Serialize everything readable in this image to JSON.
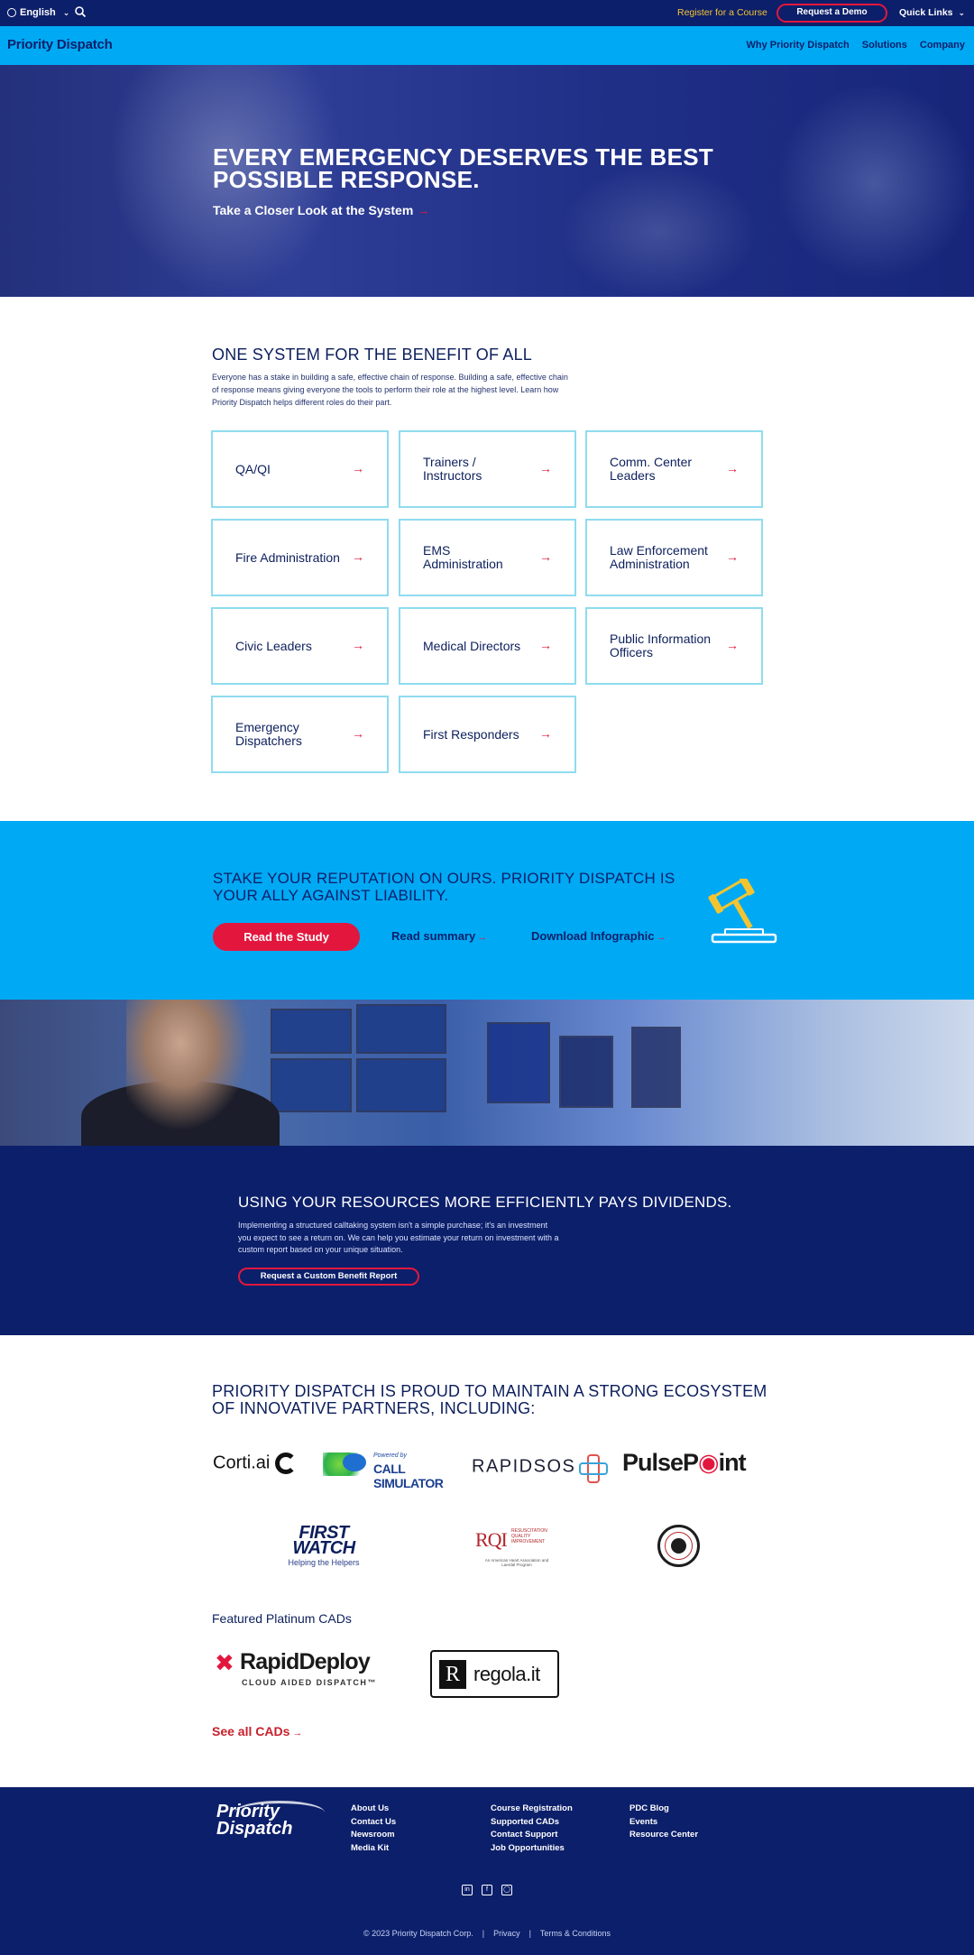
{
  "topbar": {
    "language": "English",
    "register": "Register for a Course",
    "demo": "Request a Demo",
    "quick_links": "Quick Links"
  },
  "nav": {
    "logo": "Priority Dispatch",
    "links": [
      "Why Priority Dispatch",
      "Solutions",
      "Company"
    ]
  },
  "hero": {
    "title": "EVERY EMERGENCY DESERVES THE BEST POSSIBLE RESPONSE.",
    "subtitle": "Take a Closer Look at the System"
  },
  "one_system": {
    "title": "ONE SYSTEM FOR THE BENEFIT OF ALL",
    "text": "Everyone has a stake in building a safe, effective chain of response. Building a safe, effective chain of response means giving everyone the tools to perform their role at the highest level. Learn how Priority Dispatch helps different roles do their part.",
    "cards": [
      "QA/QI",
      "Trainers / Instructors",
      "Comm. Center Leaders",
      "Fire Administration",
      "EMS Administration",
      "Law Enforcement Administration",
      "Civic Leaders",
      "Medical Directors",
      "Public Information Officers",
      "Emergency Dispatchers",
      "First Responders"
    ]
  },
  "liability": {
    "title": "STAKE YOUR REPUTATION ON OURS. PRIORITY DISPATCH IS YOUR ALLY AGAINST LIABILITY.",
    "study_button": "Read the Study",
    "summary_link": "Read summary",
    "infographic_link": "Download Infographic"
  },
  "dividends": {
    "title": "USING YOUR RESOURCES MORE EFFICIENTLY PAYS DIVIDENDS.",
    "text": "Implementing a structured calltaking system isn't a simple purchase; it's an investment you expect to see a return on. We can help you estimate your return on investment with a custom report based on your unique situation.",
    "button": "Request a Custom Benefit Report"
  },
  "partners": {
    "title": "PRIORITY DISPATCH IS PROUD TO MAINTAIN A STRONG ECOSYSTEM OF INNOVATIVE PARTNERS, INCLUDING:",
    "corti": "Corti.ai",
    "callsim_powered": "Powered by",
    "callsim": "CALL SIMULATOR",
    "rapidsos": "RAPIDSOS",
    "pulsepoint_a": "PulseP",
    "pulsepoint_b": "int",
    "firstwatch": "FIRST WATCH",
    "firstwatch_tag": "Helping the Helpers",
    "rqi": "RQI",
    "rqi_sub": "RESUSCITATION QUALITY IMPROVEMENT",
    "rqi_bottom": "An American Heart Association and Laerdal Program",
    "featured_title": "Featured Platinum CADs",
    "rapiddeploy": "RapidDeploy",
    "rapiddeploy_tag": "CLOUD AIDED DISPATCH™",
    "regola_r": "R",
    "regola": "regola.it",
    "see_all": "See all CADs"
  },
  "footer": {
    "logo": "Priority Dispatch",
    "col1": [
      "About Us",
      "Contact Us",
      "Newsroom",
      "Media Kit"
    ],
    "col2": [
      "Course Registration",
      "Supported CADs",
      "Contact Support",
      "Job Opportunities"
    ],
    "col3": [
      "PDC Blog",
      "Events",
      "Resource Center"
    ],
    "copyright": "© 2023 Priority Dispatch Corp.",
    "privacy": "Privacy",
    "terms": "Terms & Conditions"
  },
  "colors": {
    "navy": "#0c1f6a",
    "sky": "#00a9f4",
    "red": "#e3173e",
    "gold": "#f4c430"
  },
  "icons": [
    "globe-icon",
    "search-icon",
    "chevron-down-icon",
    "arrow-right-icon",
    "gavel-icon",
    "linkedin-icon",
    "facebook-icon",
    "instagram-icon"
  ]
}
